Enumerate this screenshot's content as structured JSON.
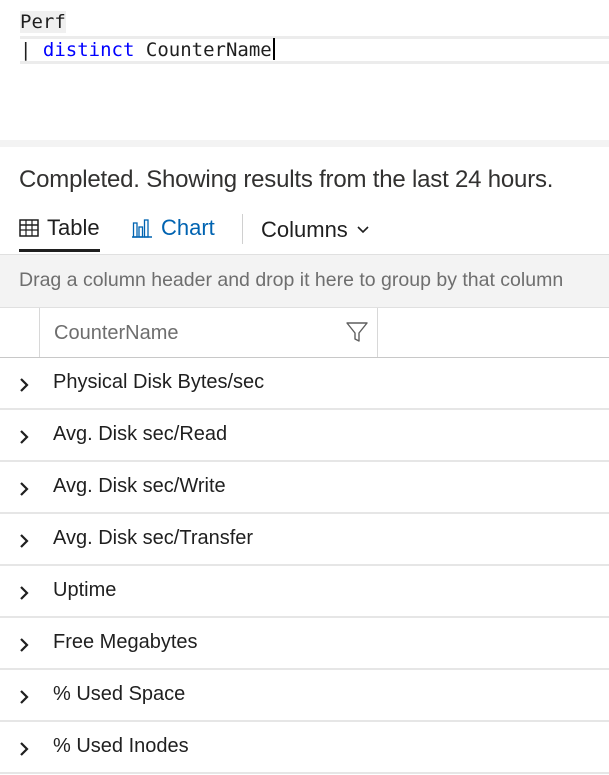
{
  "editor": {
    "line1": "Perf",
    "line2_pipe": "|",
    "line2_keyword": "distinct",
    "line2_ident": "CounterName"
  },
  "status": "Completed. Showing results from the last 24 hours.",
  "toolbar": {
    "table_label": "Table",
    "chart_label": "Chart",
    "columns_label": "Columns",
    "icons": {
      "table": "table-icon",
      "chart": "bar-chart-icon",
      "columns": "chevron-down-icon"
    }
  },
  "groupbar": {
    "text": "Drag a column header and drop it here to group by that column"
  },
  "grid": {
    "columns": [
      "CounterName"
    ],
    "rows": [
      "Physical Disk Bytes/sec",
      "Avg. Disk sec/Read",
      "Avg. Disk sec/Write",
      "Avg. Disk sec/Transfer",
      "Uptime",
      "Free Megabytes",
      "% Used Space",
      "% Used Inodes"
    ]
  },
  "colors": {
    "keyword": "#0000ff",
    "link": "#0063b1",
    "muted": "#6e6e6e",
    "groupbar_bg": "#f3f3f3"
  }
}
